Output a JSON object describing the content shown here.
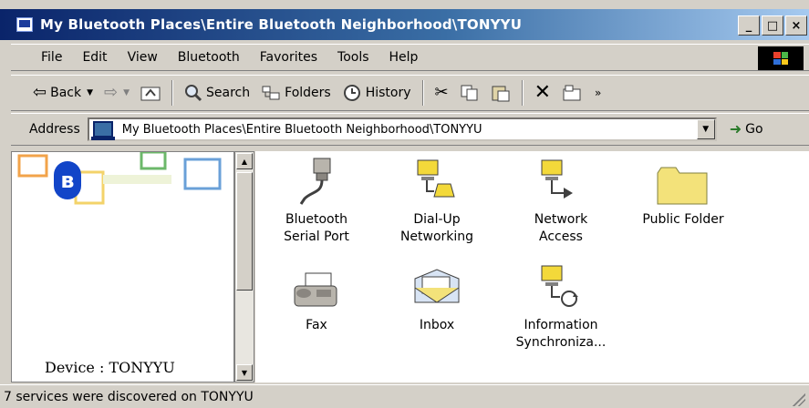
{
  "window": {
    "title": "My Bluetooth Places\\Entire Bluetooth Neighborhood\\TONYYU",
    "controls": {
      "minimize": "_",
      "maximize": "□",
      "close": "×"
    }
  },
  "menu": [
    "File",
    "Edit",
    "View",
    "Bluetooth",
    "Favorites",
    "Tools",
    "Help"
  ],
  "toolbar": {
    "back": "Back",
    "search": "Search",
    "folders": "Folders",
    "history": "History"
  },
  "address": {
    "label": "Address",
    "value": "My Bluetooth Places\\Entire Bluetooth Neighborhood\\TONYYU",
    "go": "Go"
  },
  "left_pane": {
    "device_label": "Device : TONYYU",
    "bluetooth_badge": "ʙ"
  },
  "items": [
    {
      "label_line1": "Bluetooth",
      "label_line2": "Serial Port",
      "icon": "serial-port-icon"
    },
    {
      "label_line1": "Dial-Up",
      "label_line2": "Networking",
      "icon": "dial-up-icon"
    },
    {
      "label_line1": "Network",
      "label_line2": "Access",
      "icon": "network-access-icon"
    },
    {
      "label_line1": "Public Folder",
      "label_line2": "",
      "icon": "folder-icon"
    },
    {
      "label_line1": "Fax",
      "label_line2": "",
      "icon": "fax-icon"
    },
    {
      "label_line1": "Inbox",
      "label_line2": "",
      "icon": "inbox-icon"
    },
    {
      "label_line1": "Information",
      "label_line2": "Synchroniza...",
      "icon": "sync-icon"
    }
  ],
  "status": {
    "text": "7 services were discovered on TONYYU"
  },
  "colors": {
    "title_start": "#0a246a",
    "title_end": "#a6caf0",
    "face": "#d4d0c8",
    "folder": "#f3e27a",
    "bluetooth": "#1245c8"
  }
}
